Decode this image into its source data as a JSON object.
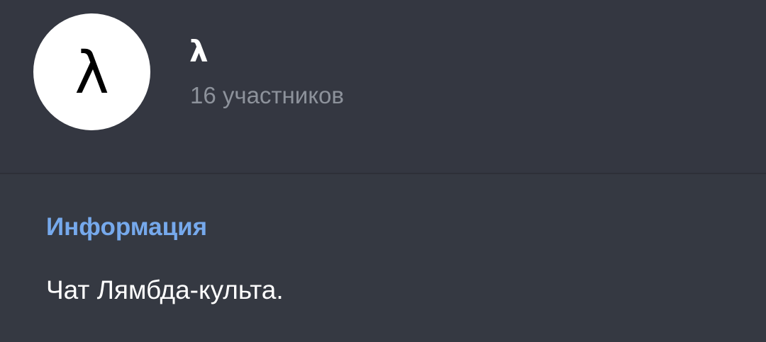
{
  "header": {
    "avatar_letter": "λ",
    "chat_name": "λ",
    "members": "16 участников"
  },
  "info": {
    "title": "Информация",
    "description": "Чат Лямбда-культа."
  },
  "colors": {
    "header_bg": "#343741",
    "section_bg": "#353942",
    "accent": "#76a9ec",
    "secondary_text": "#8d929b"
  }
}
